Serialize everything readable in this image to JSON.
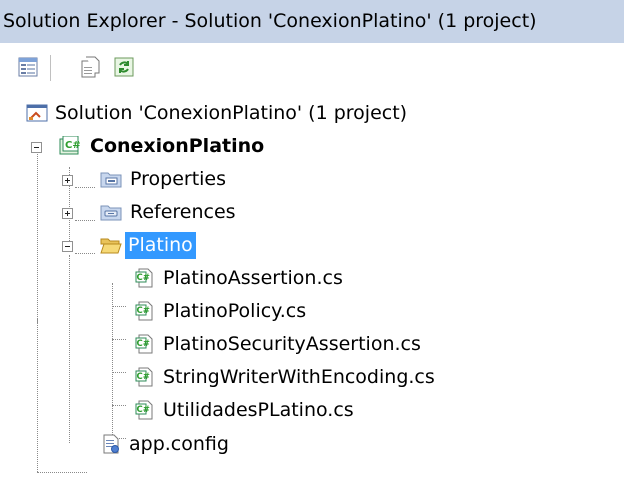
{
  "window": {
    "title": "Solution Explorer - Solution 'ConexionPlatino' (1 project)"
  },
  "toolbar": {
    "buttons": [
      {
        "name": "properties-button",
        "icon": "properties-icon"
      },
      {
        "name": "show-all-files-button",
        "icon": "show-all-files-icon"
      },
      {
        "name": "refresh-button",
        "icon": "refresh-icon"
      }
    ]
  },
  "tree": {
    "solution": {
      "label": "Solution 'ConexionPlatino' (1 project)",
      "icon": "solution-icon"
    },
    "project": {
      "label": "ConexionPlatino",
      "icon": "csharp-project-icon",
      "expanded": true
    },
    "properties": {
      "label": "Properties",
      "icon": "properties-folder-icon",
      "expanded": false
    },
    "references": {
      "label": "References",
      "icon": "references-folder-icon",
      "expanded": false
    },
    "folder": {
      "label": "Platino",
      "icon": "open-folder-icon",
      "expanded": true,
      "selected": true
    },
    "files": [
      {
        "label": "PlatinoAssertion.cs",
        "icon": "csharp-file-icon"
      },
      {
        "label": "PlatinoPolicy.cs",
        "icon": "csharp-file-icon"
      },
      {
        "label": "PlatinoSecurityAssertion.cs",
        "icon": "csharp-file-icon"
      },
      {
        "label": "StringWriterWithEncoding.cs",
        "icon": "csharp-file-icon"
      },
      {
        "label": "UtilidadesPLatino.cs",
        "icon": "csharp-file-icon"
      }
    ],
    "config": {
      "label": "app.config",
      "icon": "config-file-icon"
    }
  },
  "colors": {
    "titlebar_bg": "#c6d3e7",
    "selection_bg": "#3399ff",
    "csharp_green": "#2e9e2e"
  }
}
